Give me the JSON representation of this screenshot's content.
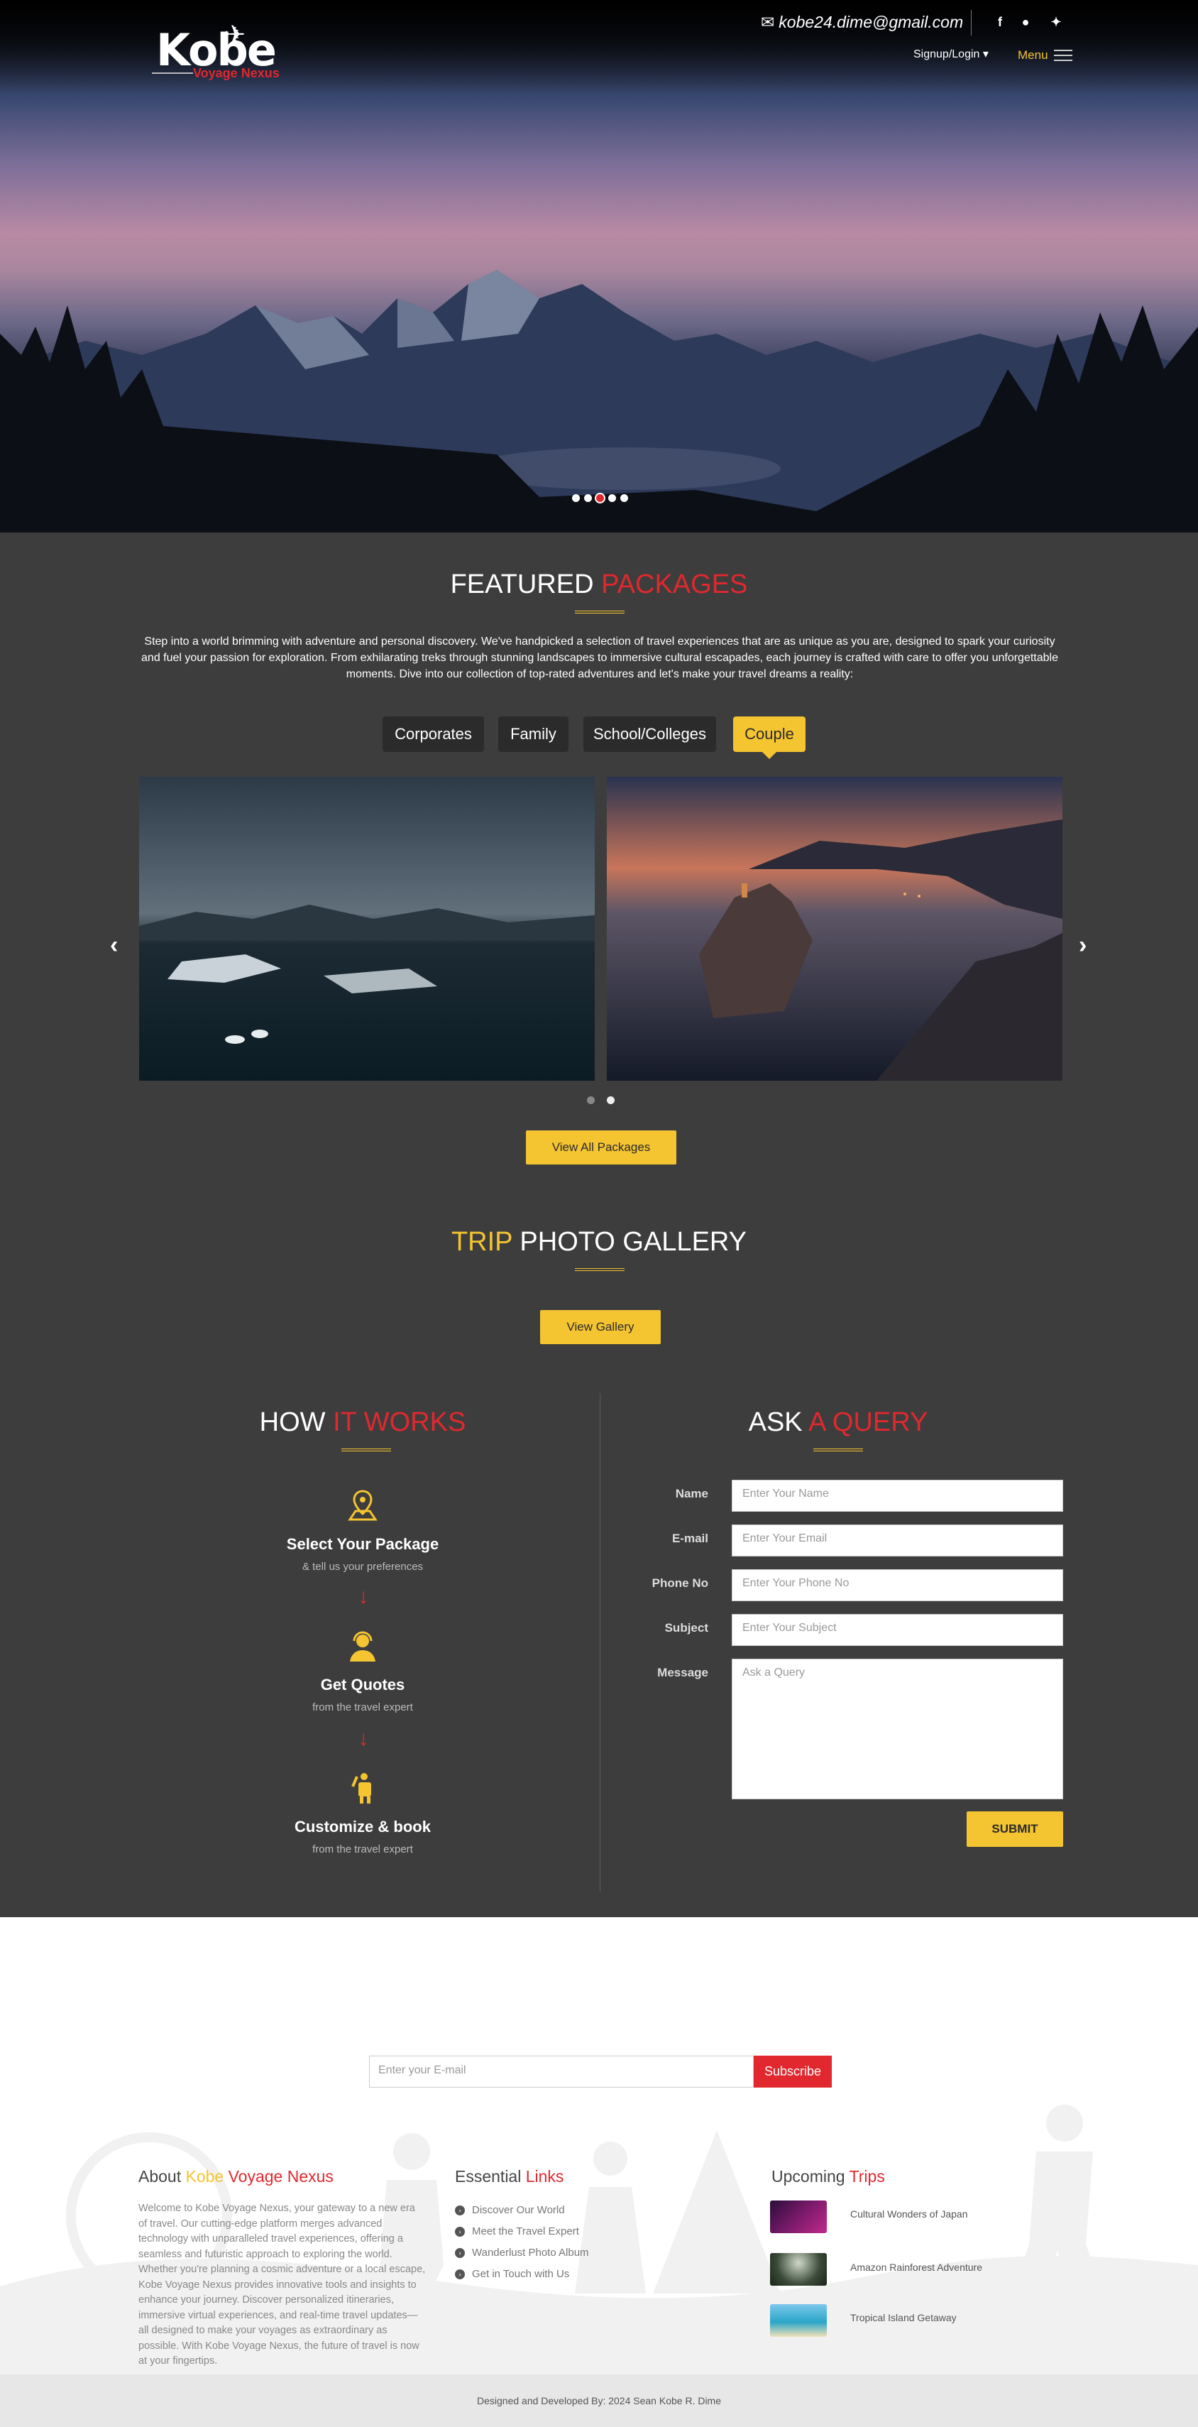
{
  "brand": {
    "name": "Kobe",
    "tagline": "Voyage Nexus"
  },
  "header": {
    "email": "kobe24.dime@gmail.com",
    "social": [
      "facebook-icon",
      "github-icon",
      "twitter-icon"
    ],
    "signup": "Signup/Login",
    "menu": "Menu"
  },
  "hero": {
    "active_slide": 3,
    "slides": 5
  },
  "featured": {
    "title_a": "FEATURED",
    "title_b": "PACKAGES",
    "intro": "Step into a world brimming with adventure and personal discovery. We've handpicked a selection of travel experiences that are as unique as you are, designed to spark your curiosity and fuel your passion for exploration. From exhilarating treks through stunning landscapes to immersive cultural escapades, each journey is crafted with care to offer you unforgettable moments. Dive into our collection of top-rated adventures and let's make your travel dreams a reality:",
    "tabs": [
      "Corporates",
      "Family",
      "School/Colleges",
      "Couple"
    ],
    "active_tab": "Couple",
    "view_all": "View All Packages"
  },
  "gallery": {
    "title_a": "TRIP",
    "title_b": "PHOTO GALLERY",
    "button": "View Gallery"
  },
  "how": {
    "title_a": "HOW",
    "title_b": "IT WORKS",
    "steps": [
      {
        "title": "Select Your Package",
        "sub": "& tell us your preferences"
      },
      {
        "title": "Get Quotes",
        "sub": "from the travel expert"
      },
      {
        "title": "Customize & book",
        "sub": "from the travel expert"
      }
    ]
  },
  "query": {
    "title_a": "ASK",
    "title_b": "A QUERY",
    "fields": [
      {
        "label": "Name",
        "placeholder": "Enter Your Name"
      },
      {
        "label": "E-mail",
        "placeholder": "Enter Your Email"
      },
      {
        "label": "Phone No",
        "placeholder": "Enter Your Phone No"
      },
      {
        "label": "Subject",
        "placeholder": "Enter Your Subject"
      },
      {
        "label": "Message",
        "placeholder": "Ask a Query"
      }
    ],
    "submit": "SUBMIT"
  },
  "newsletter": {
    "placeholder": "Enter your E-mail",
    "button": "Subscribe"
  },
  "footer": {
    "about_title_a": "About",
    "about_title_b": "Kobe",
    "about_title_c": "Voyage Nexus",
    "about": "Welcome to Kobe Voyage Nexus, your gateway to a new era of travel. Our cutting-edge platform merges advanced technology with unparalleled travel experiences, offering a seamless and futuristic approach to exploring the world. Whether you're planning a cosmic adventure or a local escape, Kobe Voyage Nexus provides innovative tools and insights to enhance your journey. Discover personalized itineraries, immersive virtual experiences, and real-time travel updates—all designed to make your voyages as extraordinary as possible. With Kobe Voyage Nexus, the future of travel is now at your fingertips.",
    "links_title_a": "Essential",
    "links_title_b": "Links",
    "links": [
      "Discover Our World",
      "Meet the Travel Expert",
      "Wanderlust Photo Album",
      "Get in Touch with Us"
    ],
    "trips_title_a": "Upcoming",
    "trips_title_b": "Trips",
    "trips": [
      "Cultural Wonders of Japan",
      "Amazon Rainforest Adventure",
      "Tropical Island Getaway"
    ],
    "copyright": "Designed and Developed By: 2024 Sean Kobe R. Dime"
  },
  "colors": {
    "accent": "#f4c431",
    "brand_red": "#e0282e",
    "dark_bg": "#3d3d3d"
  }
}
